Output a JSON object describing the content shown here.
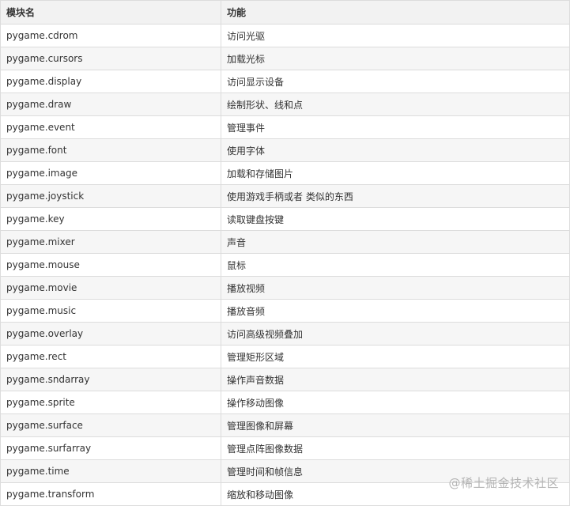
{
  "table": {
    "headers": [
      "模块名",
      "功能"
    ],
    "rows": [
      [
        "pygame.cdrom",
        "访问光驱"
      ],
      [
        "pygame.cursors",
        "加载光标"
      ],
      [
        "pygame.display",
        "访问显示设备"
      ],
      [
        "pygame.draw",
        "绘制形状、线和点"
      ],
      [
        "pygame.event",
        "管理事件"
      ],
      [
        "pygame.font",
        "使用字体"
      ],
      [
        "pygame.image",
        "加载和存储图片"
      ],
      [
        "pygame.joystick",
        "使用游戏手柄或者 类似的东西"
      ],
      [
        "pygame.key",
        "读取键盘按键"
      ],
      [
        "pygame.mixer",
        "声音"
      ],
      [
        "pygame.mouse",
        "鼠标"
      ],
      [
        "pygame.movie",
        "播放视频"
      ],
      [
        "pygame.music",
        "播放音频"
      ],
      [
        "pygame.overlay",
        "访问高级视频叠加"
      ],
      [
        "pygame.rect",
        "管理矩形区域"
      ],
      [
        "pygame.sndarray",
        "操作声音数据"
      ],
      [
        "pygame.sprite",
        "操作移动图像"
      ],
      [
        "pygame.surface",
        "管理图像和屏幕"
      ],
      [
        "pygame.surfarray",
        "管理点阵图像数据"
      ],
      [
        "pygame.time",
        "管理时间和帧信息"
      ],
      [
        "pygame.transform",
        "缩放和移动图像"
      ]
    ]
  },
  "watermark": {
    "text": "@稀土掘金技术社区"
  },
  "colors": {
    "header_bg": "#f2f2f2",
    "stripe_bg": "#f6f6f6",
    "border": "#dcdcdc",
    "text": "#333333",
    "watermark": "#b4b4b4"
  }
}
